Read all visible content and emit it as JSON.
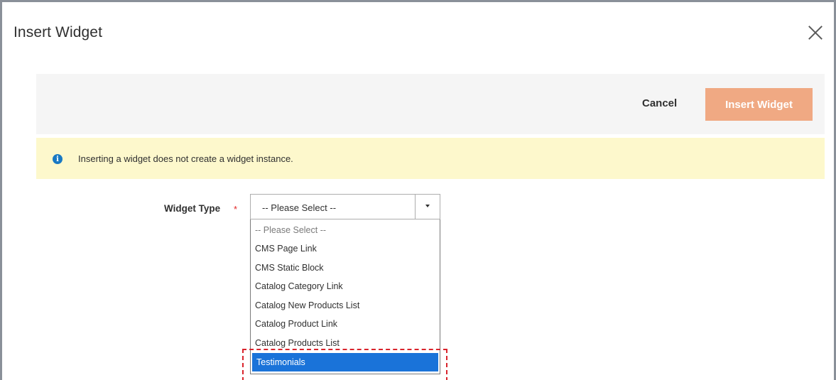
{
  "modal": {
    "title": "Insert Widget"
  },
  "actions": {
    "cancel_label": "Cancel",
    "insert_label": "Insert Widget"
  },
  "notice": {
    "text": "Inserting a widget does not create a widget instance.",
    "icon": "info-icon",
    "icon_glyph": "i"
  },
  "widget_type": {
    "label": "Widget Type",
    "required_mark": "*",
    "selected_value": "-- Please Select --",
    "options": [
      "-- Please Select --",
      "CMS Page Link",
      "CMS Static Block",
      "Catalog Category Link",
      "Catalog New Products List",
      "Catalog Product Link",
      "Catalog Products List",
      "Testimonials"
    ],
    "highlighted_option": "Testimonials"
  },
  "colors": {
    "primary_button": "#f0a983",
    "notice_background": "#fdf8cc",
    "info_icon": "#1979c3",
    "selected_option": "#1a73d9",
    "required": "#e22626",
    "annotation_highlight": "#d9242c"
  }
}
